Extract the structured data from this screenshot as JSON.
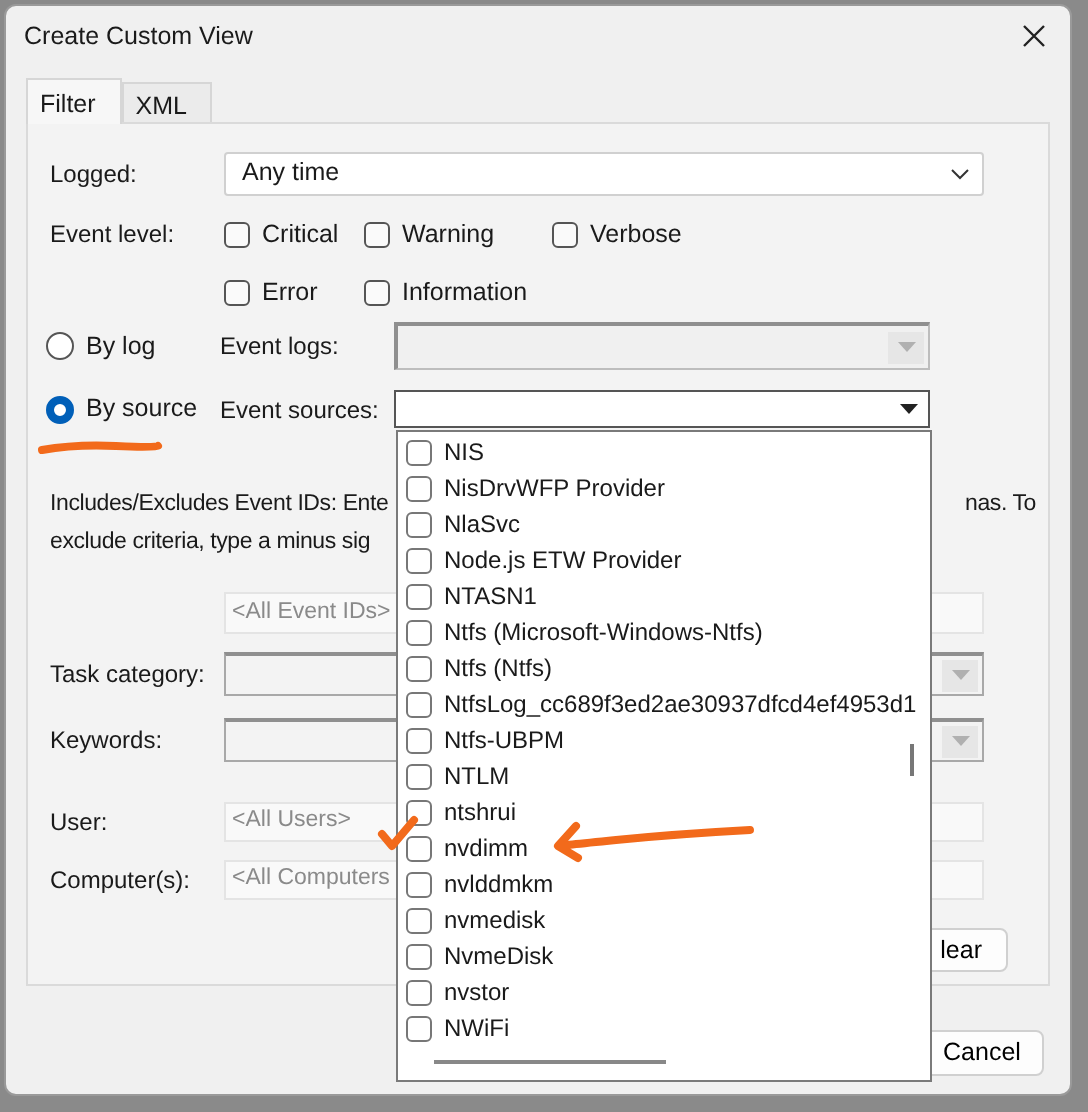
{
  "window": {
    "title": "Create Custom View"
  },
  "tabs": [
    {
      "label": "Filter",
      "selected": true
    },
    {
      "label": "XML",
      "selected": false
    }
  ],
  "logged": {
    "label": "Logged:",
    "value": "Any time"
  },
  "event_level": {
    "label": "Event level:",
    "options": [
      {
        "label": "Critical",
        "checked": false
      },
      {
        "label": "Warning",
        "checked": false
      },
      {
        "label": "Verbose",
        "checked": false
      },
      {
        "label": "Error",
        "checked": false
      },
      {
        "label": "Information",
        "checked": false
      }
    ]
  },
  "source_mode": [
    {
      "label": "By log",
      "selected": false,
      "field_label": "Event logs:"
    },
    {
      "label": "By source",
      "selected": true,
      "field_label": "Event sources:"
    }
  ],
  "event_sources": {
    "expanded": true,
    "items": [
      {
        "label": "NIS",
        "checked": false
      },
      {
        "label": "NisDrvWFP Provider",
        "checked": false
      },
      {
        "label": "NlaSvc",
        "checked": false
      },
      {
        "label": "Node.js ETW Provider",
        "checked": false
      },
      {
        "label": "NTASN1",
        "checked": false
      },
      {
        "label": "Ntfs (Microsoft-Windows-Ntfs)",
        "checked": false
      },
      {
        "label": "Ntfs (Ntfs)",
        "checked": false
      },
      {
        "label": "NtfsLog_cc689f3ed2ae30937dfcd4ef4953d1",
        "checked": false
      },
      {
        "label": "Ntfs-UBPM",
        "checked": false
      },
      {
        "label": "NTLM",
        "checked": false
      },
      {
        "label": "ntshrui",
        "checked": false
      },
      {
        "label": "nvdimm",
        "checked": false
      },
      {
        "label": "nvlddmkm",
        "checked": false
      },
      {
        "label": "nvmedisk",
        "checked": false
      },
      {
        "label": "NvmeDisk",
        "checked": false
      },
      {
        "label": "nvstor",
        "checked": false
      },
      {
        "label": "NWiFi",
        "checked": false
      }
    ]
  },
  "event_ids": {
    "line_1_start": "Includes/Excludes Event IDs: Ente",
    "line_1_end": "nas. To",
    "line_2_start": "exclude criteria, type a minus sig",
    "placeholder": "<All Event IDs>"
  },
  "task_category": {
    "label": "Task category:"
  },
  "keywords": {
    "label": "Keywords:"
  },
  "user": {
    "label": "User:",
    "placeholder": "<All Users>"
  },
  "computers": {
    "label": "Computer(s):",
    "placeholder": "<All Computers"
  },
  "buttons": [
    {
      "label": "lear"
    },
    {
      "label": "Cancel"
    }
  ],
  "annotations": [
    {
      "kind": "underline",
      "color": "#f26a1b"
    },
    {
      "kind": "arrow",
      "color": "#f26a1b"
    },
    {
      "kind": "checkmark",
      "color": "#f26a1b"
    }
  ]
}
